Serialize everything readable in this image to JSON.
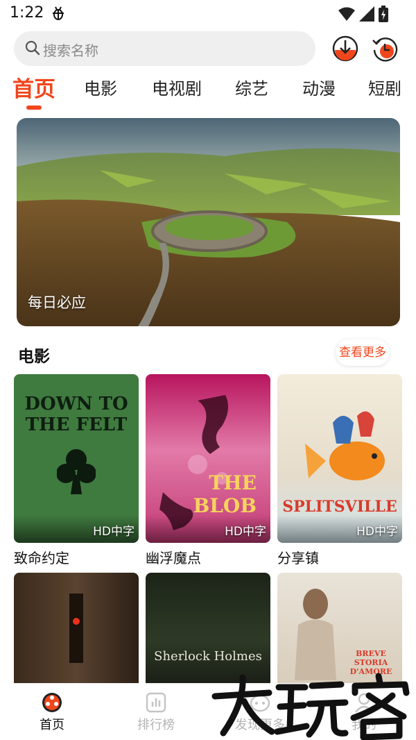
{
  "status_bar": {
    "time": "1:22"
  },
  "search": {
    "placeholder": "搜索名称"
  },
  "tabs": [
    {
      "label": "首页",
      "active": true
    },
    {
      "label": "电影"
    },
    {
      "label": "电视剧"
    },
    {
      "label": "综艺"
    },
    {
      "label": "动漫"
    },
    {
      "label": "短剧"
    }
  ],
  "banner": {
    "caption": "每日必应"
  },
  "section": {
    "title": "电影",
    "more_label": "查看更多"
  },
  "movies": [
    {
      "title": "致命约定",
      "badge": "HD中字",
      "poster_text": "DOWN TO THE FELT"
    },
    {
      "title": "幽浮魔点",
      "badge": "HD中字",
      "poster_text": "THE BLOB"
    },
    {
      "title": "分享镇",
      "badge": "HD中字",
      "poster_text": "SPLITSVILLE"
    },
    {
      "title": "",
      "poster_text": ""
    },
    {
      "title": "",
      "poster_text": "Sherlock Holmes"
    },
    {
      "title": "",
      "poster_text": "BREVE STORIA D'AMORE"
    }
  ],
  "bottom_nav": [
    {
      "label": "首页",
      "active": true
    },
    {
      "label": "排行榜"
    },
    {
      "label": "发现更多"
    },
    {
      "label": "我的"
    }
  ],
  "watermark": {
    "text": "大玩家"
  },
  "colors": {
    "accent": "#f0461c",
    "inactive": "#b4b4b4"
  }
}
